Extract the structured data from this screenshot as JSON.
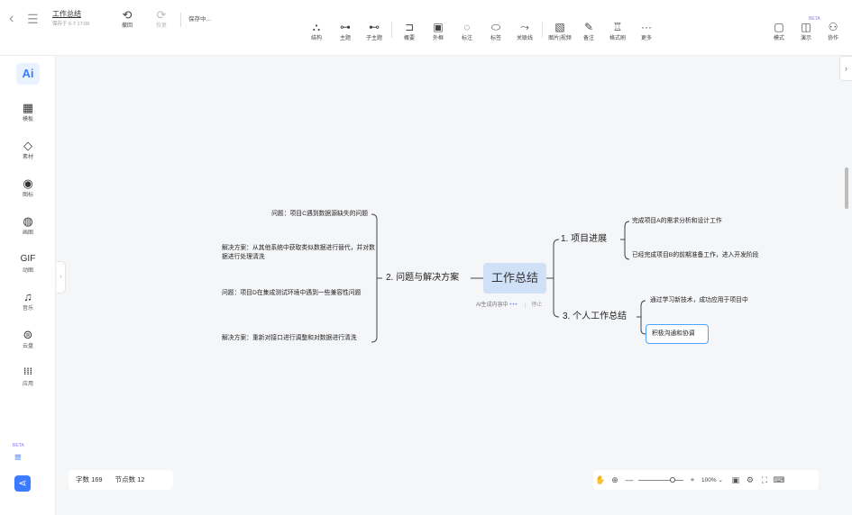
{
  "header": {
    "back_icon": "chevron-left-icon",
    "menu_icon": "menu-icon",
    "doc_title": "工作总结",
    "save_time": "保存于 6-7 17:06",
    "undo_label": "撤回",
    "redo_label": "恢复",
    "status_text": "保存中..."
  },
  "toolbar": {
    "tools": [
      {
        "icon": "structure-icon",
        "glyph": "⛬",
        "label": "结构"
      },
      {
        "icon": "topic-icon",
        "glyph": "⊶",
        "label": "主题"
      },
      {
        "icon": "subtopic-icon",
        "glyph": "⊷",
        "label": "子主题"
      },
      {
        "icon": "summary-icon",
        "glyph": "⊐",
        "label": "概要"
      },
      {
        "icon": "boundary-icon",
        "glyph": "▣",
        "label": "外框"
      },
      {
        "icon": "annotation-icon",
        "glyph": "◌",
        "label": "标注"
      },
      {
        "icon": "tag-icon",
        "glyph": "⬭",
        "label": "标签"
      },
      {
        "icon": "relation-icon",
        "glyph": "⤳",
        "label": "关联线"
      },
      {
        "icon": "image-icon",
        "glyph": "▧",
        "label": "图片|视频"
      },
      {
        "icon": "note-icon",
        "glyph": "✎",
        "label": "备注"
      },
      {
        "icon": "format-brush-icon",
        "glyph": "♖",
        "label": "格式刷"
      },
      {
        "icon": "more-icon",
        "glyph": "···",
        "label": "更多"
      }
    ],
    "right": [
      {
        "icon": "mode-icon",
        "glyph": "▢",
        "label": "模式"
      },
      {
        "icon": "present-icon",
        "glyph": "◫",
        "label": "演示",
        "badge": "BETA"
      },
      {
        "icon": "collab-icon",
        "glyph": "⚇",
        "label": "协作"
      }
    ]
  },
  "sidebar": {
    "ai_label": "Ai",
    "items": [
      {
        "icon": "template-icon",
        "glyph": "▦",
        "label": "模板"
      },
      {
        "icon": "material-icon",
        "glyph": "◇",
        "label": "素材"
      },
      {
        "icon": "icon-library-icon",
        "glyph": "◉",
        "label": "图标"
      },
      {
        "icon": "palette-icon",
        "glyph": "◍",
        "label": "画图"
      },
      {
        "icon": "gif-icon",
        "glyph": "GIF",
        "label": "动图"
      },
      {
        "icon": "music-icon",
        "glyph": "♫",
        "label": "音乐"
      },
      {
        "icon": "cloud-disk-icon",
        "glyph": "⊜",
        "label": "云盘"
      },
      {
        "icon": "apps-icon",
        "glyph": "⁞⁞⁞",
        "label": "应用"
      }
    ],
    "beta_label": "BETA",
    "outline_icon": "outline-icon",
    "mindmap_icon": "mindmap-icon"
  },
  "mindmap": {
    "central": "工作总结",
    "right_branches": [
      {
        "label": "1. 项目进展",
        "children": [
          "完成项目A的需求分析和设计工作",
          "已经完成项目B的前期准备工作，进入开发阶段"
        ]
      },
      {
        "label": "3. 个人工作总结",
        "children": [
          "通过学习新技术，成功应用于项目中",
          "积极沟通和协调"
        ]
      }
    ],
    "left_branch": {
      "label": "2. 问题与解决方案",
      "children": [
        "问题：项目C遇到数据源缺失的问题",
        "解决方案：从其他系统中获取类似数据进行替代，并对数据进行处理清洗",
        "问题：项目D在集成测试环境中遇到一些兼容性问题",
        "解决方案：重新对接口进行调整和对数据进行清洗"
      ]
    },
    "ai_status": "AI生成内容中",
    "ai_stop": "停止"
  },
  "footer": {
    "word_count": "字数 169",
    "node_count": "节点数 12",
    "zoom_level": 0.8,
    "zoom_text": "100%",
    "zoom_minus": "—",
    "zoom_plus": "+"
  },
  "colors": {
    "central_bg": "#cfe0f7",
    "selected_border": "#4ea3ff",
    "accent": "#3a7bff"
  }
}
